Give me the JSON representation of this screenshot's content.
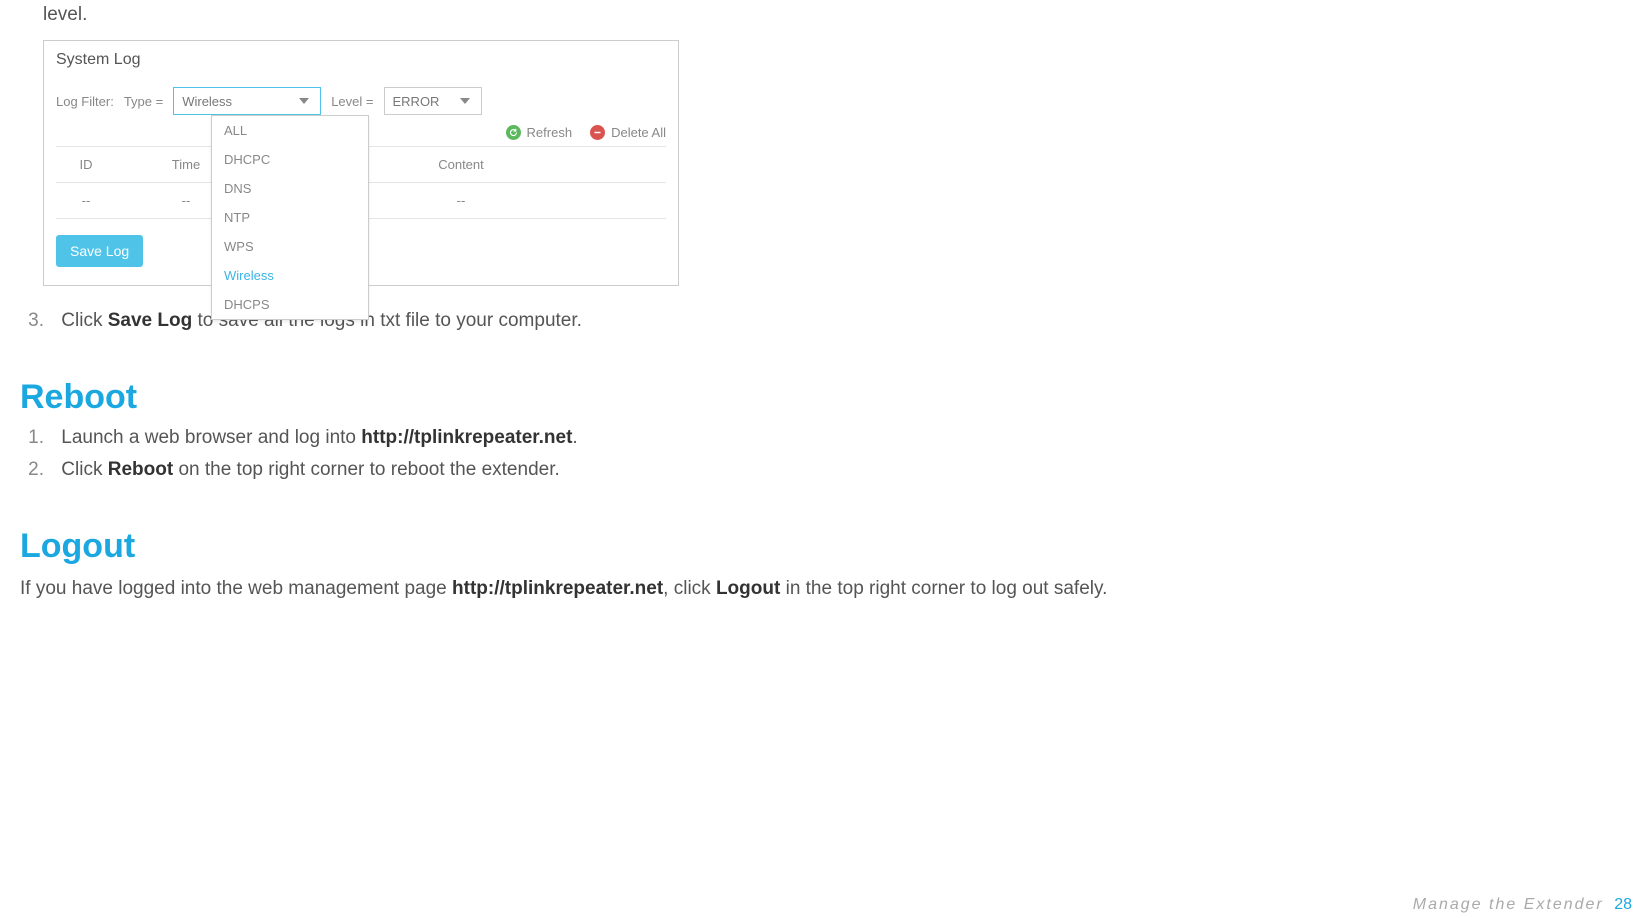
{
  "top_fragment": "level.",
  "screenshot": {
    "title": "System Log",
    "filter_label": "Log Filter:",
    "type_label": "Type =",
    "type_value": "Wireless",
    "level_label": "Level =",
    "level_value": "ERROR",
    "dropdown": [
      "ALL",
      "DHCPC",
      "DNS",
      "NTP",
      "WPS",
      "Wireless",
      "DHCPS"
    ],
    "dropdown_active": "Wireless",
    "refresh": "Refresh",
    "delete_all": "Delete All",
    "table_headers": [
      "ID",
      "Time",
      "Content"
    ],
    "table_row": [
      "--",
      "--",
      "--"
    ],
    "save_button": "Save Log"
  },
  "step3_num": "3.",
  "step3_a": "Click ",
  "step3_b": "Save Log",
  "step3_c": " to save all the logs in txt file to your computer.",
  "reboot_heading": "Reboot",
  "reboot_1_num": "1.",
  "reboot_1_a": "Launch a web browser and log into ",
  "reboot_1_b": "http://tplinkrepeater.net",
  "reboot_1_c": ".",
  "reboot_2_num": "2.",
  "reboot_2_a": "Click ",
  "reboot_2_b": "Reboot",
  "reboot_2_c": " on the top right corner to reboot the extender.",
  "logout_heading": "Logout",
  "logout_a": "If you have logged into the web management page ",
  "logout_b": "http://tplinkrepeater.net",
  "logout_c": ", click ",
  "logout_d": "Logout",
  "logout_e": " in the top right corner to log out safely.",
  "footer_text": "Manage  the  Extender",
  "footer_page": "28"
}
